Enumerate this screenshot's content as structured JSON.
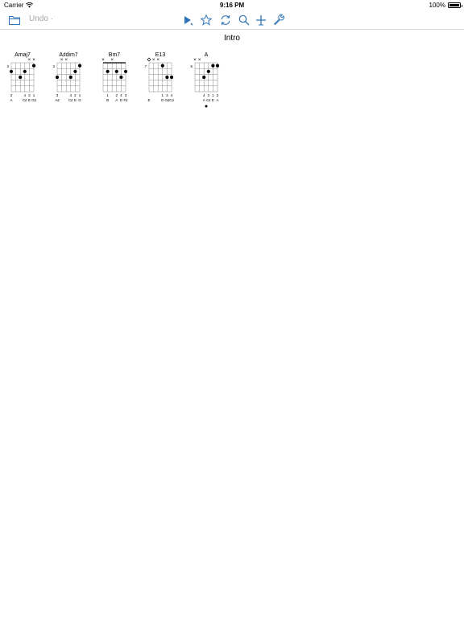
{
  "status_bar": {
    "carrier": "Carrier",
    "time": "9:16 PM",
    "battery": "100%",
    "battery_level": 1.0
  },
  "toolbar": {
    "undo_label": "Undo",
    "undo_suffix": "·",
    "accent_color": "#2f74b7",
    "icons": [
      "folder-icon",
      "play-icon",
      "star-icon",
      "rotate-icon",
      "search-icon",
      "add-icon",
      "wrench-icon"
    ]
  },
  "section_title": "Intro",
  "chords": [
    {
      "name": "Amaj7",
      "base_fret": "3",
      "muted": [
        4,
        5
      ],
      "open": [],
      "barre": false,
      "dots": [
        [
          0,
          2
        ],
        [
          3,
          2
        ],
        [
          2,
          3
        ],
        [
          5,
          1
        ]
      ],
      "fingers": [
        "2",
        "",
        "",
        "4",
        "3",
        "1"
      ],
      "notes": [
        "A",
        "",
        "",
        "C♯",
        "E",
        "G♯"
      ],
      "mark": false
    },
    {
      "name": "A♯dim7",
      "base_fret": "3",
      "muted": [
        1,
        2
      ],
      "open": [],
      "barre": false,
      "dots": [
        [
          0,
          3
        ],
        [
          3,
          3
        ],
        [
          4,
          2
        ],
        [
          5,
          1
        ]
      ],
      "fingers": [
        "3",
        "",
        "",
        "4",
        "2",
        "1"
      ],
      "notes": [
        "A♯",
        "",
        "",
        "C♯",
        "E",
        "G"
      ],
      "mark": false
    },
    {
      "name": "Bm7",
      "base_fret": "",
      "muted": [
        0,
        2
      ],
      "open": [],
      "barre": true,
      "dots": [
        [
          1,
          2
        ],
        [
          3,
          2
        ],
        [
          4,
          3
        ],
        [
          5,
          2
        ]
      ],
      "fingers": [
        "",
        "1",
        "",
        "2",
        "4",
        "3"
      ],
      "notes": [
        "",
        "B",
        "",
        "A",
        "D",
        "F♯"
      ],
      "mark": false
    },
    {
      "name": "E13",
      "base_fret": "7",
      "muted": [
        1,
        2
      ],
      "open": [
        0
      ],
      "barre": false,
      "dots": [
        [
          3,
          1
        ],
        [
          4,
          3
        ],
        [
          5,
          3
        ]
      ],
      "fingers": [
        "",
        "",
        "",
        "1",
        "3",
        "4"
      ],
      "notes": [
        "E",
        "",
        "",
        "D",
        "G♯",
        "C♯"
      ],
      "mark": false
    },
    {
      "name": "A",
      "base_fret": "5",
      "muted": [
        0,
        1
      ],
      "open": [],
      "barre": false,
      "dots": [
        [
          2,
          3
        ],
        [
          3,
          2
        ],
        [
          4,
          1
        ],
        [
          5,
          1
        ]
      ],
      "fingers": [
        "",
        "",
        "4",
        "3",
        "1",
        "2"
      ],
      "notes": [
        "",
        "",
        "A",
        "C♯",
        "E",
        "A"
      ],
      "mark": true
    }
  ]
}
